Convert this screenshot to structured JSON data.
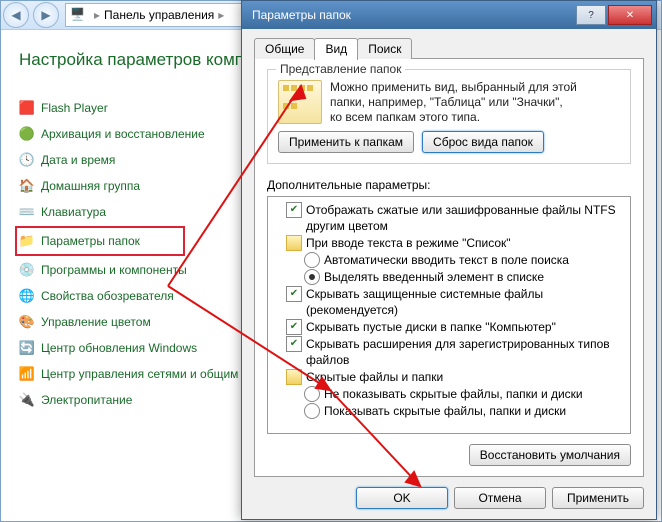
{
  "addressbar": {
    "crumb": "Панель управления"
  },
  "heading": "Настройка параметров компьютера",
  "sidebar": {
    "items": [
      {
        "label": "Flash Player",
        "icon": "🟥"
      },
      {
        "label": "Архивация и восстановление",
        "icon": "🟢"
      },
      {
        "label": "Дата и время",
        "icon": "🕓"
      },
      {
        "label": "Домашняя группа",
        "icon": "🏠"
      },
      {
        "label": "Клавиатура",
        "icon": "⌨️"
      },
      {
        "label": "Параметры папок",
        "icon": "📁",
        "selected": true
      },
      {
        "label": "Программы и компоненты",
        "icon": "💿"
      },
      {
        "label": "Свойства обозревателя",
        "icon": "🌐"
      },
      {
        "label": "Управление цветом",
        "icon": "🎨"
      },
      {
        "label": "Центр обновления Windows",
        "icon": "🔄"
      },
      {
        "label": "Центр управления сетями и общим доступом",
        "icon": "📶"
      },
      {
        "label": "Электропитание",
        "icon": "🔌"
      }
    ]
  },
  "dialog": {
    "title": "Параметры папок",
    "tabs": {
      "general": "Общие",
      "view": "Вид",
      "search": "Поиск"
    },
    "view_group_title": "Представление папок",
    "view_desc1": "Можно применить вид, выбранный для этой",
    "view_desc2": "папки, например, \"Таблица\" или \"Значки\",",
    "view_desc3": "ко всем папкам этого типа.",
    "apply_to_folders": "Применить к папкам",
    "reset_folders": "Сброс вида папок",
    "adv_label": "Дополнительные параметры:",
    "tree": [
      {
        "lvl": 1,
        "kind": "chk",
        "checked": true,
        "label": "Отображать сжатые или зашифрованные файлы NTFS другим цветом"
      },
      {
        "lvl": 1,
        "kind": "fold",
        "label": "При вводе текста в режиме \"Список\""
      },
      {
        "lvl": 2,
        "kind": "rad",
        "checked": false,
        "label": "Автоматически вводить текст в поле поиска"
      },
      {
        "lvl": 2,
        "kind": "rad",
        "checked": true,
        "label": "Выделять введенный элемент в списке"
      },
      {
        "lvl": 1,
        "kind": "chk",
        "checked": true,
        "label": "Скрывать защищенные системные файлы (рекомендуется)"
      },
      {
        "lvl": 1,
        "kind": "chk",
        "checked": true,
        "label": "Скрывать пустые диски в папке \"Компьютер\""
      },
      {
        "lvl": 1,
        "kind": "chk",
        "checked": true,
        "label": "Скрывать расширения для зарегистрированных типов файлов"
      },
      {
        "lvl": 1,
        "kind": "fold",
        "label": "Скрытые файлы и папки"
      },
      {
        "lvl": 2,
        "kind": "rad",
        "checked": false,
        "label": "Не показывать скрытые файлы, папки и диски"
      },
      {
        "lvl": 2,
        "kind": "rad",
        "checked": false,
        "label": "Показывать скрытые файлы, папки и диски"
      }
    ],
    "restore": "Восстановить умолчания",
    "ok": "OK",
    "cancel": "Отмена",
    "apply": "Применить"
  }
}
